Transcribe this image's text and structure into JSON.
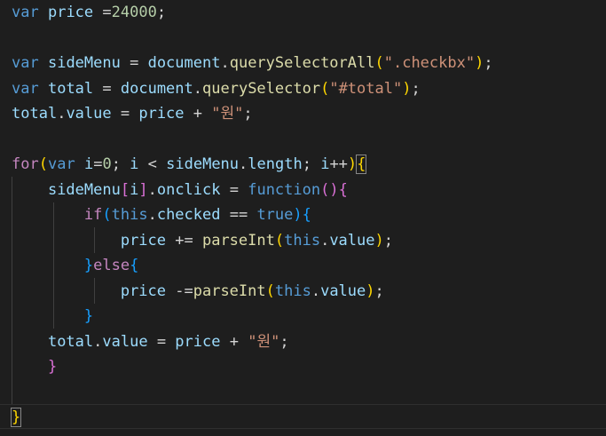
{
  "editor": {
    "lines": [
      [
        {
          "t": "var",
          "c": "kw-var"
        },
        {
          "t": " ",
          "c": "op"
        },
        {
          "t": "price",
          "c": "id"
        },
        {
          "t": " =",
          "c": "op"
        },
        {
          "t": "24000",
          "c": "num"
        },
        {
          "t": ";",
          "c": "op"
        }
      ],
      [],
      [
        {
          "t": "var",
          "c": "kw-var"
        },
        {
          "t": " ",
          "c": "op"
        },
        {
          "t": "sideMenu",
          "c": "id"
        },
        {
          "t": " = ",
          "c": "op"
        },
        {
          "t": "document",
          "c": "id"
        },
        {
          "t": ".",
          "c": "op"
        },
        {
          "t": "querySelectorAll",
          "c": "meth"
        },
        {
          "t": "(",
          "c": "p1"
        },
        {
          "t": "\".checkbx\"",
          "c": "str"
        },
        {
          "t": ")",
          "c": "p1"
        },
        {
          "t": ";",
          "c": "op"
        }
      ],
      [
        {
          "t": "var",
          "c": "kw-var"
        },
        {
          "t": " ",
          "c": "op"
        },
        {
          "t": "total",
          "c": "id"
        },
        {
          "t": " = ",
          "c": "op"
        },
        {
          "t": "document",
          "c": "id"
        },
        {
          "t": ".",
          "c": "op"
        },
        {
          "t": "querySelector",
          "c": "meth"
        },
        {
          "t": "(",
          "c": "p1"
        },
        {
          "t": "\"#total\"",
          "c": "str"
        },
        {
          "t": ")",
          "c": "p1"
        },
        {
          "t": ";",
          "c": "op"
        }
      ],
      [
        {
          "t": "total",
          "c": "id"
        },
        {
          "t": ".",
          "c": "op"
        },
        {
          "t": "value",
          "c": "prop"
        },
        {
          "t": " = ",
          "c": "op"
        },
        {
          "t": "price",
          "c": "id"
        },
        {
          "t": " + ",
          "c": "op"
        },
        {
          "t": "\"원\"",
          "c": "str"
        },
        {
          "t": ";",
          "c": "op"
        }
      ],
      [],
      [
        {
          "t": "for",
          "c": "kw-ctl"
        },
        {
          "t": "(",
          "c": "p1"
        },
        {
          "t": "var",
          "c": "kw-var"
        },
        {
          "t": " ",
          "c": "op"
        },
        {
          "t": "i",
          "c": "id"
        },
        {
          "t": "=",
          "c": "op"
        },
        {
          "t": "0",
          "c": "num"
        },
        {
          "t": "; ",
          "c": "op"
        },
        {
          "t": "i",
          "c": "id"
        },
        {
          "t": " < ",
          "c": "op"
        },
        {
          "t": "sideMenu",
          "c": "id"
        },
        {
          "t": ".",
          "c": "op"
        },
        {
          "t": "length",
          "c": "prop"
        },
        {
          "t": "; ",
          "c": "op"
        },
        {
          "t": "i",
          "c": "id"
        },
        {
          "t": "++",
          "c": "op"
        },
        {
          "t": ")",
          "c": "p1"
        },
        {
          "t": "{",
          "c": "p1 bm"
        }
      ],
      [
        {
          "t": "    ",
          "c": "op"
        },
        {
          "t": "sideMenu",
          "c": "id"
        },
        {
          "t": "[",
          "c": "p2"
        },
        {
          "t": "i",
          "c": "id"
        },
        {
          "t": "]",
          "c": "p2"
        },
        {
          "t": ".",
          "c": "op"
        },
        {
          "t": "onclick",
          "c": "prop"
        },
        {
          "t": " = ",
          "c": "op"
        },
        {
          "t": "function",
          "c": "kw-fn"
        },
        {
          "t": "()",
          "c": "p2"
        },
        {
          "t": "{",
          "c": "p2"
        }
      ],
      [
        {
          "t": "        ",
          "c": "op"
        },
        {
          "t": "if",
          "c": "kw-ctl"
        },
        {
          "t": "(",
          "c": "p3"
        },
        {
          "t": "this",
          "c": "kw-this"
        },
        {
          "t": ".",
          "c": "op"
        },
        {
          "t": "checked",
          "c": "prop"
        },
        {
          "t": " == ",
          "c": "op"
        },
        {
          "t": "true",
          "c": "kw-bool"
        },
        {
          "t": ")",
          "c": "p3"
        },
        {
          "t": "{",
          "c": "p3"
        }
      ],
      [
        {
          "t": "            ",
          "c": "op"
        },
        {
          "t": "price",
          "c": "id"
        },
        {
          "t": " += ",
          "c": "op"
        },
        {
          "t": "parseInt",
          "c": "meth"
        },
        {
          "t": "(",
          "c": "p1"
        },
        {
          "t": "this",
          "c": "kw-this"
        },
        {
          "t": ".",
          "c": "op"
        },
        {
          "t": "value",
          "c": "prop"
        },
        {
          "t": ")",
          "c": "p1"
        },
        {
          "t": ";",
          "c": "op"
        }
      ],
      [
        {
          "t": "        ",
          "c": "op"
        },
        {
          "t": "}",
          "c": "p3"
        },
        {
          "t": "else",
          "c": "kw-ctl"
        },
        {
          "t": "{",
          "c": "p3"
        }
      ],
      [
        {
          "t": "            ",
          "c": "op"
        },
        {
          "t": "price",
          "c": "id"
        },
        {
          "t": " -=",
          "c": "op"
        },
        {
          "t": "parseInt",
          "c": "meth"
        },
        {
          "t": "(",
          "c": "p1"
        },
        {
          "t": "this",
          "c": "kw-this"
        },
        {
          "t": ".",
          "c": "op"
        },
        {
          "t": "value",
          "c": "prop"
        },
        {
          "t": ")",
          "c": "p1"
        },
        {
          "t": ";",
          "c": "op"
        }
      ],
      [
        {
          "t": "        ",
          "c": "op"
        },
        {
          "t": "}",
          "c": "p3"
        }
      ],
      [
        {
          "t": "    ",
          "c": "op"
        },
        {
          "t": "total",
          "c": "id"
        },
        {
          "t": ".",
          "c": "op"
        },
        {
          "t": "value",
          "c": "prop"
        },
        {
          "t": " = ",
          "c": "op"
        },
        {
          "t": "price",
          "c": "id"
        },
        {
          "t": " + ",
          "c": "op"
        },
        {
          "t": "\"원\"",
          "c": "str"
        },
        {
          "t": ";",
          "c": "op"
        }
      ],
      [
        {
          "t": "    ",
          "c": "op"
        },
        {
          "t": "}",
          "c": "p2"
        }
      ],
      [],
      [
        {
          "t": "}",
          "c": "p1 bm"
        }
      ]
    ]
  }
}
